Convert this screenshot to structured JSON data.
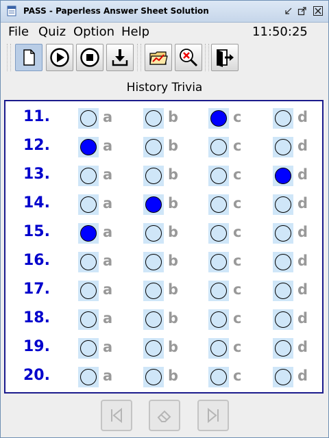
{
  "window": {
    "title": "PASS - Paperless Answer Sheet Solution",
    "controls": [
      "minimize-icon",
      "maximize-icon",
      "close-icon"
    ]
  },
  "menu": {
    "items": [
      "File",
      "Quiz",
      "Option",
      "Help"
    ],
    "clock": "11:50:25"
  },
  "toolbar": {
    "buttons": [
      {
        "name": "new-button",
        "icon": "new-document-icon",
        "active": true
      },
      {
        "name": "start-button",
        "icon": "play-icon"
      },
      {
        "name": "stop-button",
        "icon": "stop-icon"
      },
      {
        "name": "download-button",
        "icon": "download-icon"
      },
      {
        "name": "open-results-button",
        "icon": "folder-chart-icon"
      },
      {
        "name": "clear-search-button",
        "icon": "magnifier-x-icon"
      },
      {
        "name": "exit-button",
        "icon": "exit-door-icon"
      }
    ]
  },
  "quiz": {
    "title": "History Trivia"
  },
  "answer_sheet": {
    "options": [
      "a",
      "b",
      "c",
      "d"
    ],
    "questions": [
      {
        "number": "11.",
        "selected": "c"
      },
      {
        "number": "12.",
        "selected": "a"
      },
      {
        "number": "13.",
        "selected": "d"
      },
      {
        "number": "14.",
        "selected": "b"
      },
      {
        "number": "15.",
        "selected": "a"
      },
      {
        "number": "16.",
        "selected": null
      },
      {
        "number": "17.",
        "selected": null
      },
      {
        "number": "18.",
        "selected": null
      },
      {
        "number": "19.",
        "selected": null
      },
      {
        "number": "20.",
        "selected": null
      }
    ]
  },
  "navigation": {
    "buttons": [
      {
        "name": "first-page-button",
        "icon": "skip-back-icon",
        "enabled": false
      },
      {
        "name": "erase-button",
        "icon": "eraser-icon",
        "enabled": false
      },
      {
        "name": "last-page-button",
        "icon": "skip-forward-icon",
        "enabled": false
      }
    ]
  },
  "colors": {
    "question_number": "#0000cc",
    "bubble_fill": "#0000ff",
    "bubble_empty": "#cfe6f8",
    "option_letter": "#999999",
    "sheet_border": "#1a1a8c"
  }
}
